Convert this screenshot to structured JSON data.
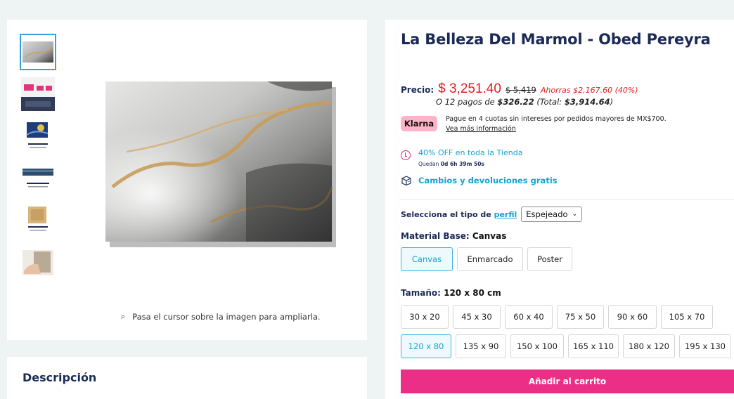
{
  "gallery": {
    "zoom_hint": "Pasa el cursor sobre la imagen para ampliarla."
  },
  "description": {
    "title": "Descripción"
  },
  "product": {
    "title": "La Belleza Del Marmol - Obed Pereyra",
    "price_label": "Precio:",
    "price_current": "$ 3,251.40",
    "price_old": "$ 5,419",
    "price_savings": "Ahorras $2,167.60 (40%)",
    "installments_prefix": "O 12 pagos de ",
    "installments_amount": "$326.22",
    "installments_total_prefix": " (Total: ",
    "installments_total": "$3,914.64",
    "installments_suffix": ")"
  },
  "klarna": {
    "badge": "Klarna",
    "text": "Pague en 4 cuotas sin intereses por pedidos mayores de MX$700.",
    "link": "Vea más información"
  },
  "promo": {
    "text": "40% OFF en toda la Tienda",
    "countdown_label": "Quedan ",
    "countdown_value": "0d 6h 39m 50s"
  },
  "returns": {
    "text": "Cambios y devoluciones gratis"
  },
  "profile": {
    "label": "Selecciona el tipo de ",
    "link": "perfil",
    "selected": "Espejeado"
  },
  "material": {
    "label": "Material Base: ",
    "value": "Canvas",
    "options": [
      "Canvas",
      "Enmarcado",
      "Poster"
    ]
  },
  "size": {
    "label": "Tamaño: ",
    "value": "120 x 80 cm",
    "options": [
      "30 x 20",
      "45 x 30",
      "60 x 40",
      "75 x 50",
      "90 x 60",
      "105 x 70",
      "120 x 80",
      "135 x 90",
      "150 x 100",
      "165 x 110",
      "180 x 120",
      "195 x 130"
    ]
  },
  "cart": {
    "label": "Añadir al carrito"
  },
  "colors": {
    "navy": "#1c2a57",
    "accent_blue": "#16a3d0",
    "price_red": "#e02020",
    "cart_pink": "#ec2f86",
    "klarna_pink": "#ffb3c7"
  }
}
